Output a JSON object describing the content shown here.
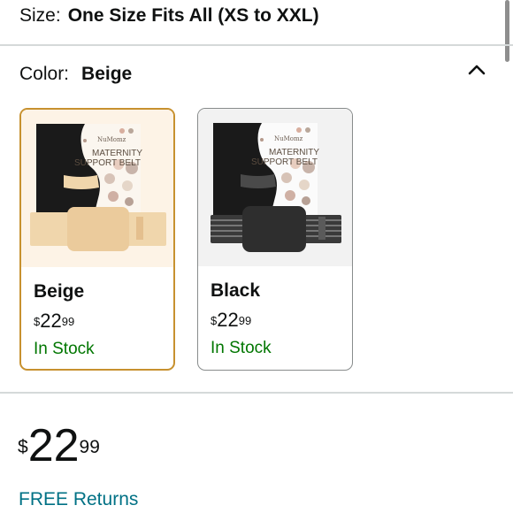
{
  "size": {
    "label": "Size:",
    "value": "One Size Fits All (XS to XXL)"
  },
  "color": {
    "label": "Color:",
    "value": "Beige",
    "toggle_icon": "chevron-up-icon"
  },
  "variants": [
    {
      "name": "Beige",
      "price": {
        "symbol": "$",
        "whole": "22",
        "fraction": "99"
      },
      "stock": "In Stock",
      "selected": true,
      "box": {
        "brand": "NuMomz",
        "line1": "MATERNITY",
        "line2": "SUPPORT BELT"
      },
      "belt_color": "#f0d6ac"
    },
    {
      "name": "Black",
      "price": {
        "symbol": "$",
        "whole": "22",
        "fraction": "99"
      },
      "stock": "In Stock",
      "selected": false,
      "box": {
        "brand": "NuMomz",
        "line1": "MATERNITY",
        "line2": "SUPPORT BELT"
      },
      "belt_color": "#2e2e2e"
    }
  ],
  "main_price": {
    "symbol": "$",
    "whole": "22",
    "fraction": "99"
  },
  "returns": {
    "label": "FREE Returns"
  },
  "colors": {
    "accent_border": "#c7912f",
    "in_stock": "#007600",
    "link": "#007185"
  }
}
